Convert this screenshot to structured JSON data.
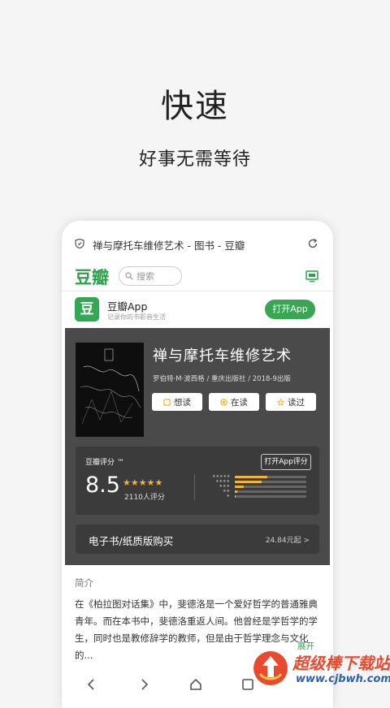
{
  "hero": {
    "title": "快速",
    "subtitle": "好事无需等待"
  },
  "browser": {
    "url_title": "禅与摩托车维修艺术 - 图书 - 豆瓣"
  },
  "nav": {
    "logo": "豆瓣",
    "search_placeholder": "搜索"
  },
  "app_banner": {
    "icon_char": "豆",
    "name": "豆瓣App",
    "description": "记录你的书影音生活",
    "open_label": "打开App"
  },
  "book": {
    "title": "禅与摩托车维修艺术",
    "meta": "罗伯特·M·波西格 / 重庆出版社 / 2018-9出版",
    "actions": [
      {
        "label": "想读",
        "icon": "bookmark-icon"
      },
      {
        "label": "在读",
        "icon": "reading-icon"
      },
      {
        "label": "读过",
        "icon": "star-icon"
      }
    ]
  },
  "rating": {
    "label": "豆瓣评分 ™",
    "score": "8.5",
    "stars": "★★★★★",
    "stars_value": 4.5,
    "count": "2110人评分",
    "open_label": "打开App评分",
    "distribution": [
      0.45,
      0.38,
      0.13,
      0.03,
      0.01
    ]
  },
  "ebook": {
    "label": "电子书/纸质版购买",
    "price": "24.84元起 >"
  },
  "intro": {
    "heading": "简介",
    "text": "在《柏拉图对话集》中，斐德洛是一个爱好哲学的普通雅典青年。而在本书中，斐德洛重返人间。他曾经是学哲学的学生，同时也是教修辞学的教师，但是由于哲学理念与文化的...",
    "expand_label": "展开"
  },
  "watermark": {
    "title": "超级棒下载站",
    "url": "www.cjbwh.com"
  },
  "colors": {
    "accent_green": "#2ea24a",
    "dark_panel": "#4a4a4a",
    "star_gold": "#f3b433"
  }
}
